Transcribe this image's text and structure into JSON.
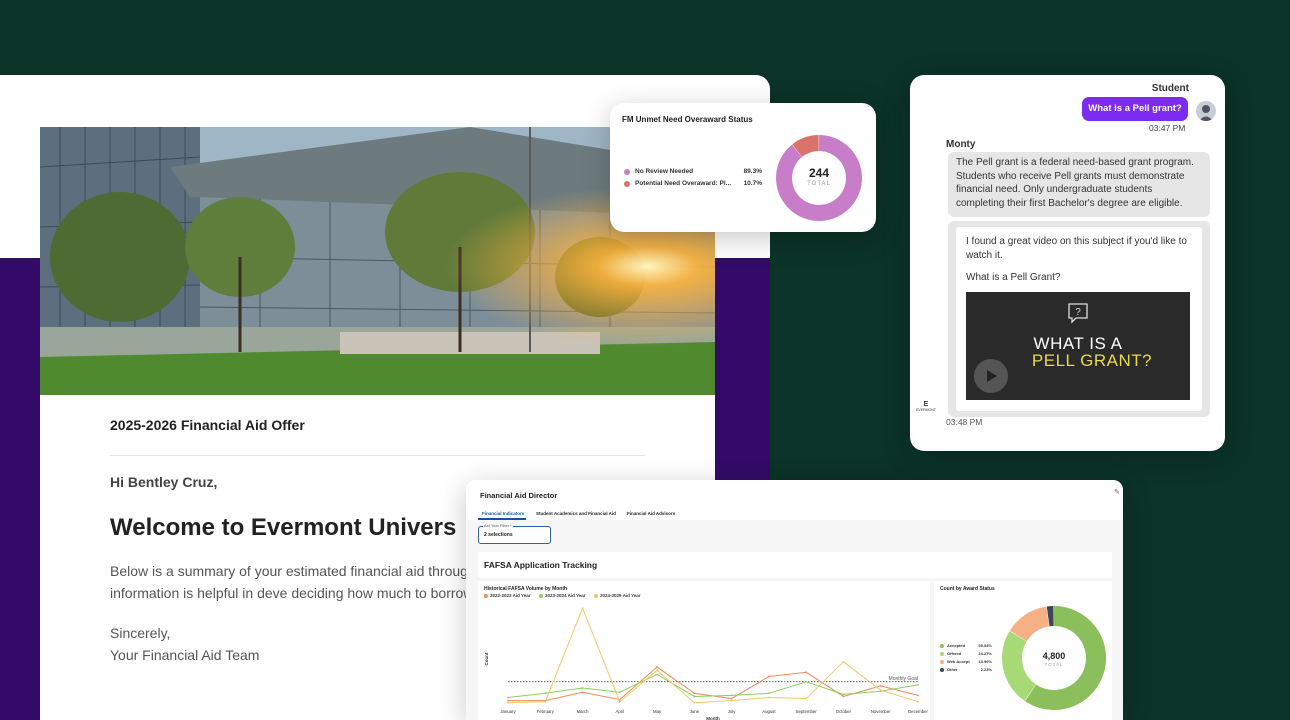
{
  "email": {
    "offer_title": "2025-2026 Financial Aid Offer",
    "greeting": "Hi Bentley Cruz,",
    "welcome": "Welcome to Evermont Univers",
    "summary": "Below is a summary of your estimated financial aid throug year. For many students, this information is helpful in deve deciding how much to borrow in student loans.",
    "sign_off": "Sincerely,",
    "signature": "Your Financial Aid Team"
  },
  "fm_card": {
    "title": "FM Unmet Need Overaward Status",
    "legend": [
      {
        "label": "No Review Needed",
        "pct": "89.3%",
        "color": "#c77dc8"
      },
      {
        "label": "Potential Need Overaward: Pl...",
        "pct": "10.7%",
        "color": "#d9736a"
      }
    ],
    "total": "244",
    "total_label": "TOTAL",
    "slices": [
      89.3,
      10.7
    ]
  },
  "chat": {
    "student_label": "Student",
    "user_message": "What is a Pell grant?",
    "user_time": "03:47 PM",
    "bot_name": "Monty",
    "bot_message": "The Pell grant is a federal need-based grant program. Students who receive Pell grants must demonstrate financial need. Only undergraduate students completing their first Bachelor's degree are eligible.",
    "video_intro": "I found a great video on this subject if you'd like to watch it.",
    "video_title": "What is a Pell Grant?",
    "video_line1": "WHAT IS A",
    "video_line2": "PELL GRANT?",
    "bot_logo": "EVERMONT",
    "bot_time": "03:48 PM"
  },
  "dashboard": {
    "title": "Financial Aid Director",
    "tabs": [
      "Financial Indicators",
      "Student Academics and Financial Aid",
      "Financial Aid Advisors"
    ],
    "filter_label": "Aid Year Filter *",
    "filter_value": "2 selections",
    "section_title": "FAFSA Application Tracking"
  },
  "chart_data": [
    {
      "type": "line",
      "title": "Historical FAFSA Volume by Month",
      "xlabel": "Month",
      "ylabel": "Count",
      "categories": [
        "January",
        "February",
        "March",
        "April",
        "May",
        "June",
        "July",
        "August",
        "September",
        "October",
        "November",
        "December"
      ],
      "series": [
        {
          "name": "2022-2023 Aid Year",
          "color": "#f08b5a",
          "values": [
            14,
            14,
            30,
            16,
            78,
            28,
            18,
            60,
            68,
            22,
            42,
            24
          ]
        },
        {
          "name": "2023-2024 Aid Year",
          "color": "#8ccf5e",
          "values": [
            20,
            28,
            38,
            30,
            64,
            22,
            24,
            28,
            50,
            26,
            32,
            44
          ]
        },
        {
          "name": "2024-2025 Aid Year",
          "color": "#f2c867",
          "values": [
            10,
            12,
            190,
            12,
            72,
            10,
            14,
            20,
            18,
            88,
            34,
            12
          ]
        }
      ],
      "reference_line": {
        "label": "Monthly Goal",
        "value": 50
      },
      "ylim": [
        0,
        200
      ]
    },
    {
      "type": "pie",
      "title": "Count by Award Status",
      "total": "4,800",
      "total_label": "TOTAL",
      "slices": [
        {
          "label": "Accepted",
          "pct": "59.54%",
          "value": 59.54,
          "color": "#8bbf5c"
        },
        {
          "label": "Offered",
          "pct": "24.27%",
          "value": 24.27,
          "color": "#a8d977"
        },
        {
          "label": "Web Accept",
          "pct": "13.96%",
          "value": 13.96,
          "color": "#f5b183"
        },
        {
          "label": "Other",
          "pct": "2.23%",
          "value": 2.23,
          "color": "#3e4658"
        }
      ]
    }
  ]
}
